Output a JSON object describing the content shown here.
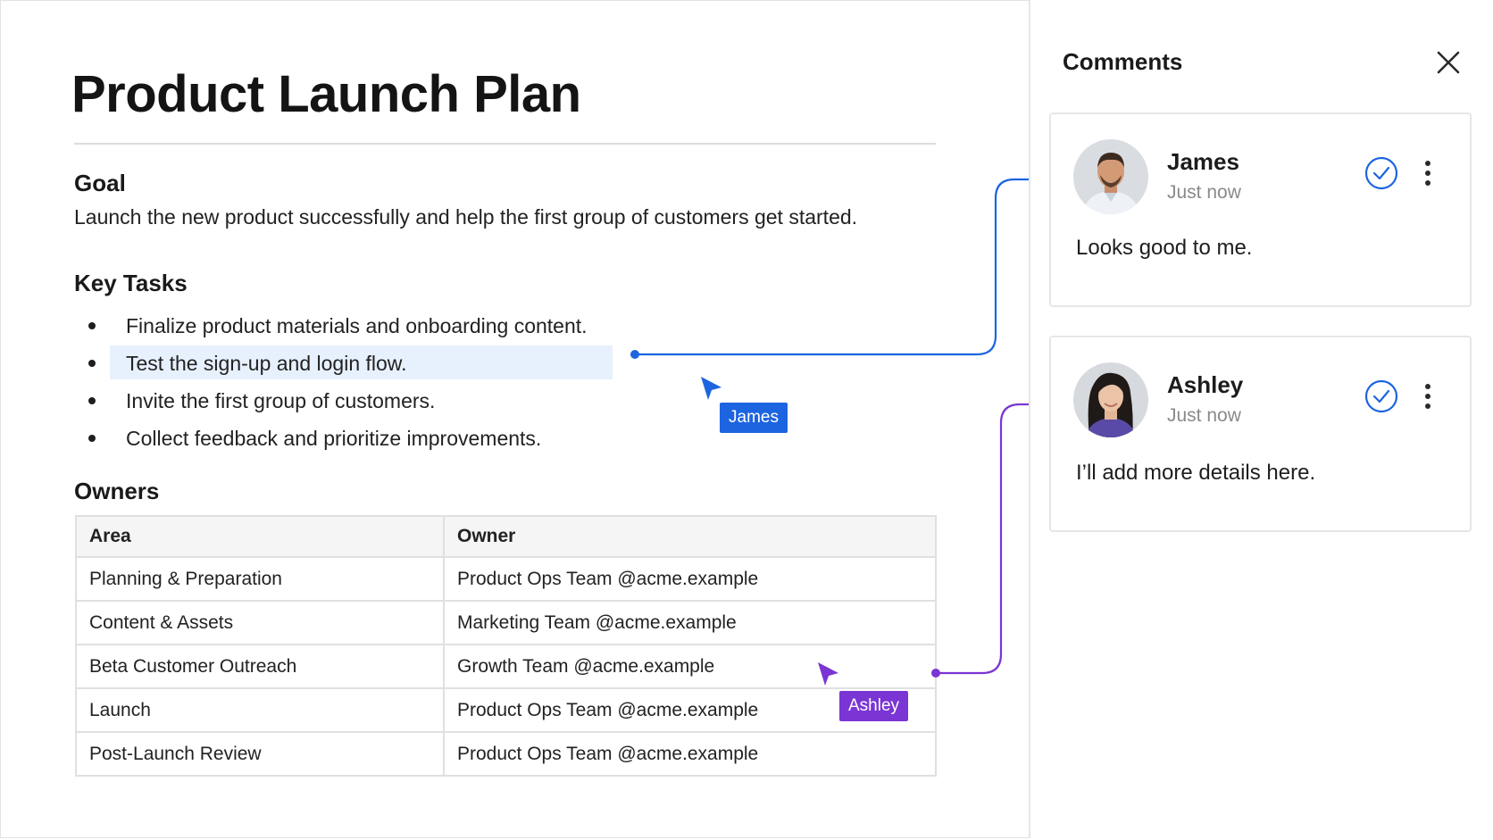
{
  "document": {
    "title": "Product Launch Plan",
    "goal": {
      "heading": "Goal",
      "text": "Launch the new product successfully and help the first group of customers get started."
    },
    "key_tasks": {
      "heading": "Key Tasks",
      "items": [
        "Finalize product materials and onboarding content.",
        "Test the sign-up and login flow.",
        "Invite the first group of customers.",
        "Collect feedback and prioritize improvements."
      ]
    },
    "owners": {
      "heading": "Owners",
      "columns": [
        "Area",
        "Owner"
      ],
      "rows": [
        [
          "Planning & Preparation",
          "Product Ops Team @acme.example"
        ],
        [
          "Content & Assets",
          "Marketing Team @acme.example"
        ],
        [
          "Beta Customer Outreach",
          "Growth Team @acme.example"
        ],
        [
          "Launch",
          "Product Ops Team @acme.example"
        ],
        [
          "Post-Launch Review",
          "Product Ops Team @acme.example"
        ]
      ]
    }
  },
  "cursors": [
    {
      "name": "James",
      "color": "#1d64e0"
    },
    {
      "name": "Ashley",
      "color": "#7a35d4"
    }
  ],
  "comments_panel": {
    "title": "Comments",
    "comments": [
      {
        "author": "James",
        "time": "Just now",
        "text": "Looks good to me."
      },
      {
        "author": "Ashley",
        "time": "Just now",
        "text": "I’ll add more details here."
      }
    ]
  },
  "colors": {
    "james_accent": "#1d64e0",
    "ashley_accent": "#7a35d4",
    "highlight": "#e7f0fd",
    "resolve_check": "#1d64e0"
  }
}
